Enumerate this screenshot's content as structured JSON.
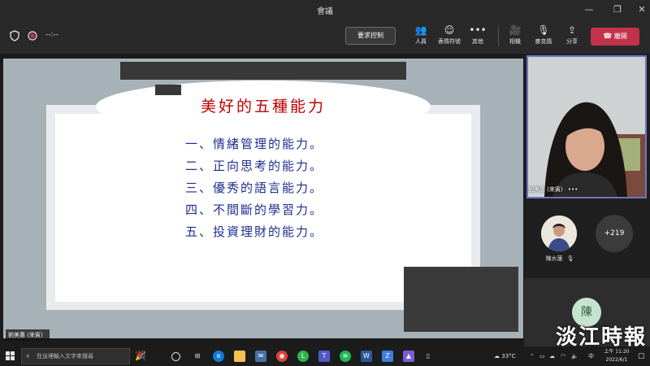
{
  "window": {
    "title": "會議",
    "controls": [
      "—",
      "❐",
      "✕"
    ]
  },
  "meeting": {
    "timer": "--:--",
    "request_control": "要求控制",
    "toolbar": [
      {
        "icon": "people-icon",
        "glyph": "👥",
        "label": "人員"
      },
      {
        "icon": "reactions-icon",
        "glyph": "☺",
        "label": "表情符號"
      },
      {
        "icon": "more-icon",
        "glyph": "•••",
        "label": "其他"
      },
      {
        "icon": "camera-off-icon",
        "glyph": "🎥",
        "label": "相機"
      },
      {
        "icon": "mic-off-icon",
        "glyph": "🎙",
        "label": "麥克風"
      },
      {
        "icon": "share-icon",
        "glyph": "⇪",
        "label": "分享"
      }
    ],
    "leave_label": "離開",
    "leave_color": "#c4314b"
  },
  "slide": {
    "title": "美好的五種能力",
    "title_color": "#c00000",
    "text_color": "#1f2f8f",
    "lines": [
      "一、情緒管理的能力。",
      "二、正向思考的能力。",
      "三、優秀的語言能力。",
      "四、不間斷的學習力。",
      "五、投資理財的能力。"
    ],
    "presenter_tag": "劉美惠 (來賓)"
  },
  "participants": {
    "main_name": "劉美惠 (來賓)",
    "main_more": "•••",
    "second_name": "陳水蓮",
    "more_count": "+219",
    "chen_initial": "陳",
    "accent": "#6c75c6"
  },
  "watermark": "淡江時報",
  "taskbar": {
    "search_placeholder": "在這裡輸入文字來搜尋",
    "weather": "33°C",
    "ime": "中",
    "time": "上午 11:20",
    "date": "2022/6/1"
  }
}
